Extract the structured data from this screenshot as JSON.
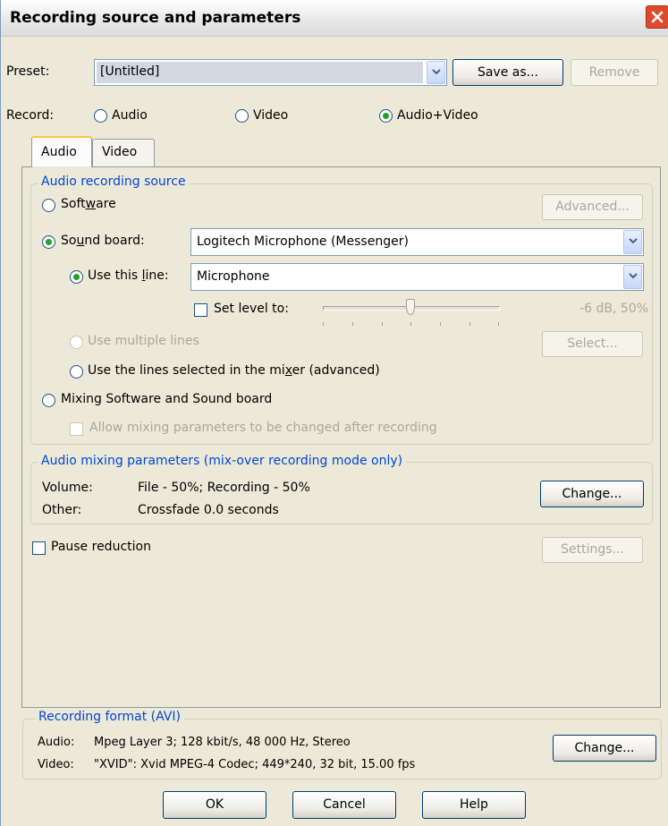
{
  "window": {
    "title": "Recording source and parameters"
  },
  "preset": {
    "label": "Preset:",
    "value": "[Untitled]",
    "save_as": "Save as...",
    "remove": "Remove"
  },
  "record": {
    "label": "Record:",
    "options": [
      "Audio",
      "Video",
      "Audio+Video"
    ],
    "selected": "Audio+Video"
  },
  "tabs": [
    {
      "label": "Audio",
      "active": true
    },
    {
      "label": "Video",
      "active": false
    }
  ],
  "audio_source": {
    "legend": "Audio recording source",
    "software_pre": "Soft",
    "software_ul": "w",
    "software_post": "are",
    "advanced": "Advanced...",
    "soundboard_pre": "So",
    "soundboard_ul": "u",
    "soundboard_post": "nd board:",
    "soundboard_value": "Logitech Microphone (Messenger)",
    "use_line_pre": "Use this ",
    "use_line_ul": "l",
    "use_line_post": "ine:",
    "line_value": "Microphone",
    "set_level": "Set level to:",
    "level_readout": "-6 dB, 50%",
    "multiple_lines": "Use multiple lines",
    "select": "Select...",
    "mixer_lines_pre": "Use the lines selected in the mi",
    "mixer_lines_ul": "x",
    "mixer_lines_post": "er (advanced)",
    "mixing": "Mixing Software and Sound board",
    "allow_mixing": "Allow mixing parameters to be changed after recording"
  },
  "mixing_params": {
    "legend": "Audio mixing parameters (mix-over recording mode only)",
    "volume_label": "Volume:",
    "volume_value": "File - 50%; Recording - 50%",
    "other_label": "Other:",
    "other_value": "Crossfade 0.0 seconds",
    "change": "Change..."
  },
  "pause_reduction": {
    "label": "Pause reduction",
    "settings": "Settings..."
  },
  "format": {
    "legend": "Recording format (AVI)",
    "audio_label": "Audio:",
    "audio_value": "Mpeg Layer 3; 128 kbit/s, 48 000 Hz, Stereo",
    "video_label": "Video:",
    "video_value": "\"XVID\": Xvid MPEG-4 Codec; 449*240, 32 bit, 15.00 fps",
    "change": "Change..."
  },
  "buttons": {
    "ok": "OK",
    "cancel": "Cancel",
    "help": "Help"
  },
  "level": {
    "fraction": 0.5
  },
  "colors": {
    "legend": "#0046d5",
    "radio_dot": "#21a121",
    "close": "#e04a2c"
  }
}
